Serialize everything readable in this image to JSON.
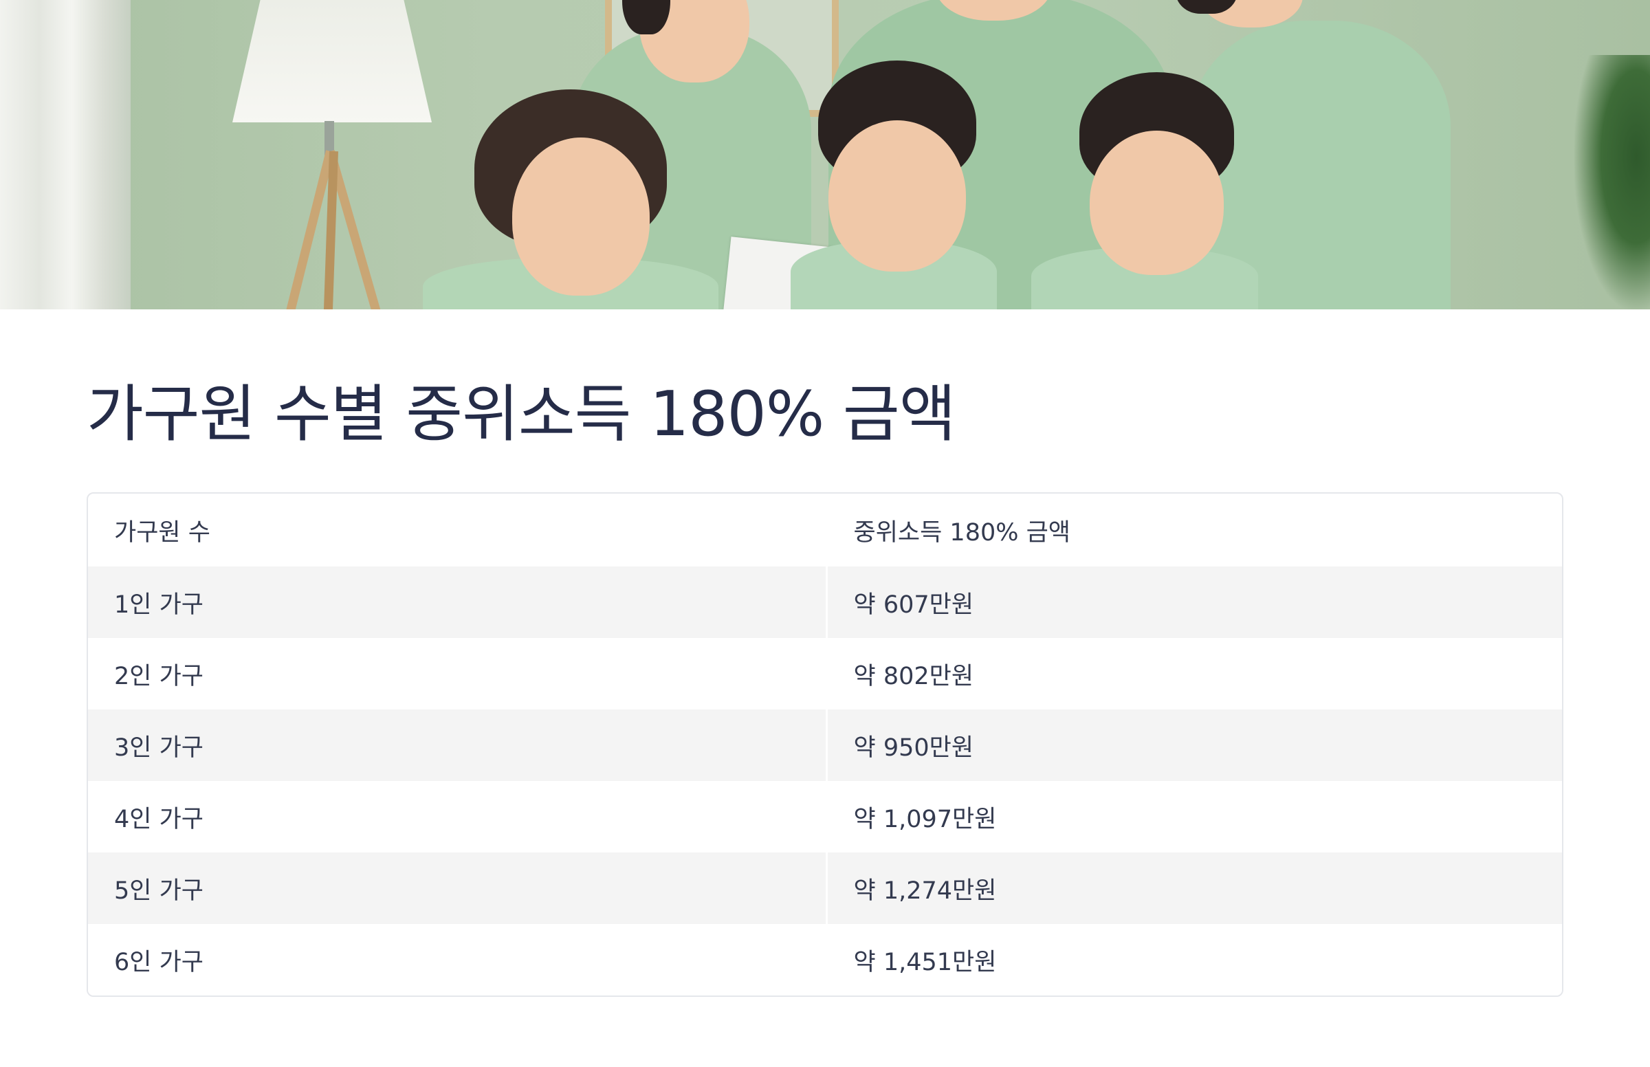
{
  "page": {
    "title": "가구원 수별 중위소득 180% 금액"
  },
  "table": {
    "headers": [
      "가구원 수",
      "중위소득 180% 금액"
    ],
    "rows": [
      [
        "1인 가구",
        "약 607만원"
      ],
      [
        "2인 가구",
        "약 802만원"
      ],
      [
        "3인 가구",
        "약 950만원"
      ],
      [
        "4인 가구",
        "약 1,097만원"
      ],
      [
        "5인 가구",
        "약 1,274만원"
      ],
      [
        "6인 가구",
        "약 1,451만원"
      ]
    ]
  },
  "colors": {
    "title_text": "#252c48",
    "row_stripe": "#f4f4f4",
    "border": "#e5e7eb",
    "hero_wall": "#b6cbb0",
    "clothing": "#a8cfae"
  }
}
